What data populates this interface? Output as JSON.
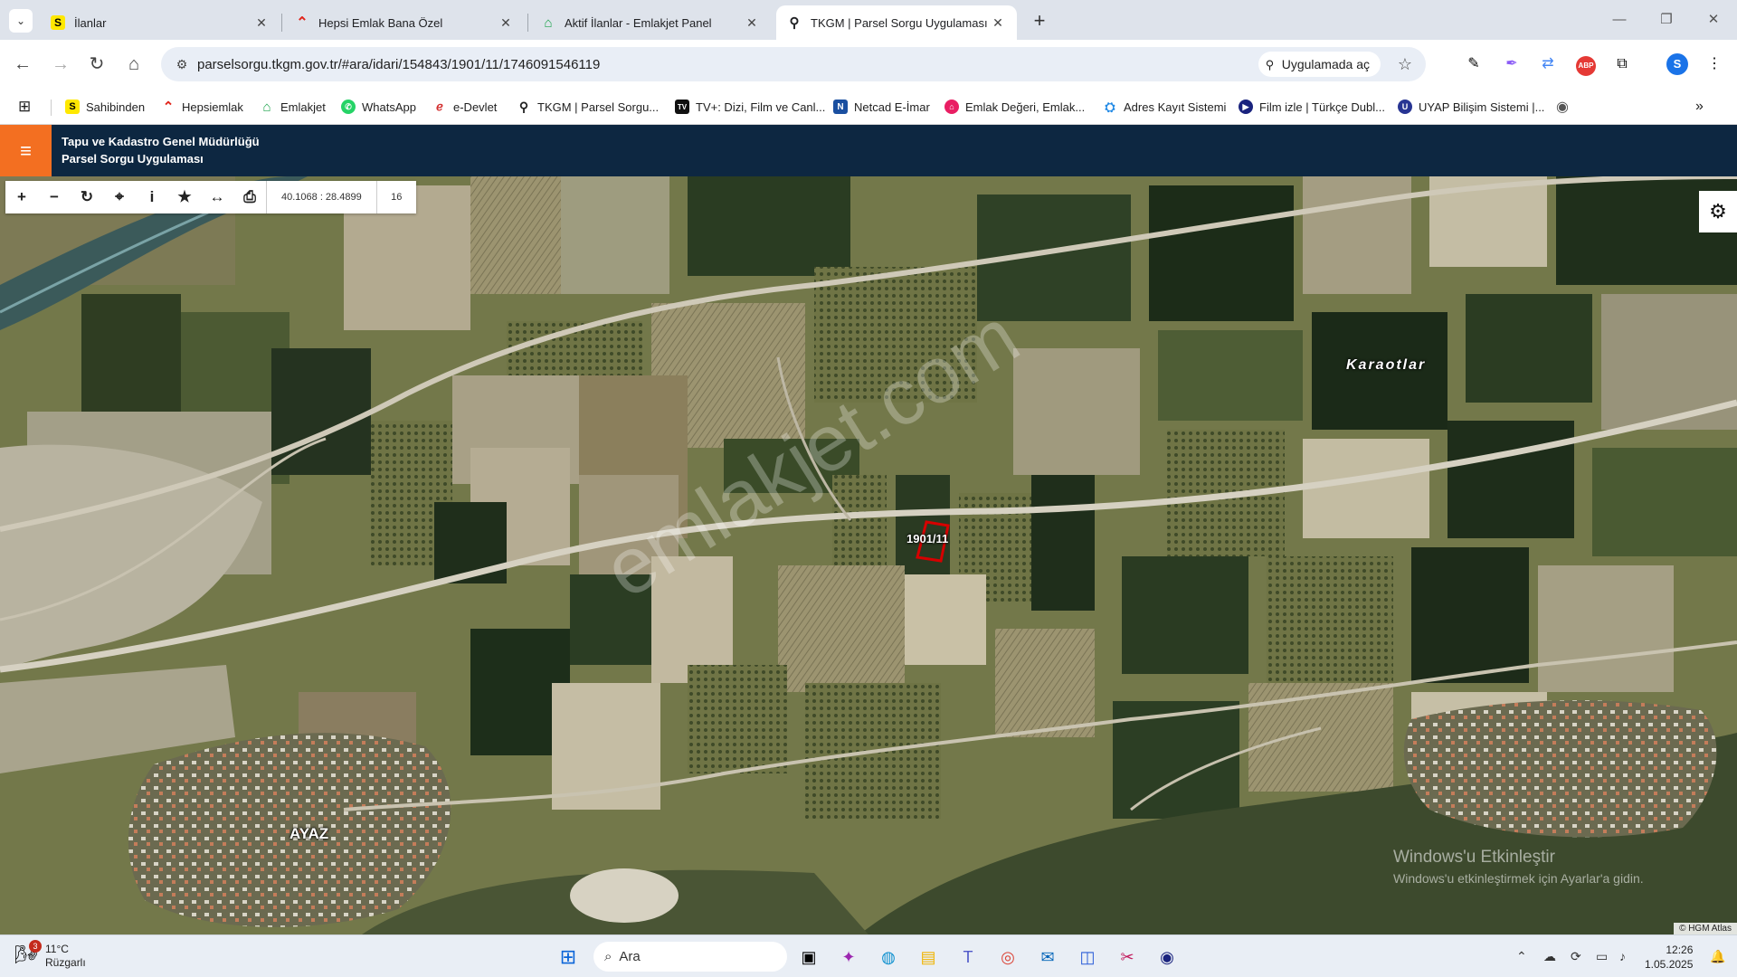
{
  "browser": {
    "tabs": [
      {
        "title": "İlanlar",
        "favicon": "sahibinden-icon"
      },
      {
        "title": "Hepsi Emlak Bana Özel",
        "favicon": "hepsiemlak-icon"
      },
      {
        "title": "Aktif İlanlar - Emlakjet Panel",
        "favicon": "emlakjet-icon"
      },
      {
        "title": "TKGM | Parsel Sorgu Uygulaması",
        "favicon": "location-pin-icon",
        "active": true
      }
    ],
    "url": "parselsorgu.tkgm.gov.tr/#ara/idari/154843/1901/11/1746091546119",
    "open_in_app_label": "Uygulamada aç",
    "profile_initial": "S",
    "bookmarks": [
      {
        "label": "Sahibinden",
        "icon": "sahibinden-icon"
      },
      {
        "label": "Hepsiemlak",
        "icon": "hepsiemlak-icon"
      },
      {
        "label": "Emlakjet",
        "icon": "emlakjet-icon"
      },
      {
        "label": "WhatsApp",
        "icon": "whatsapp-icon"
      },
      {
        "label": "e-Devlet",
        "icon": "edevlet-icon"
      },
      {
        "label": "TKGM | Parsel Sorgu...",
        "icon": "location-pin-icon"
      },
      {
        "label": "TV+: Dizi, Film ve Canl...",
        "icon": "tvplus-icon"
      },
      {
        "label": "Netcad E-İmar",
        "icon": "netcad-icon"
      },
      {
        "label": "Emlak Değeri, Emlak...",
        "icon": "emlak-degeri-icon"
      },
      {
        "label": "Adres Kayıt Sistemi",
        "icon": "adres-icon"
      },
      {
        "label": "Film izle | Türkçe Dubl...",
        "icon": "film-icon"
      },
      {
        "label": "UYAP Bilişim Sistemi |...",
        "icon": "uyap-icon"
      }
    ]
  },
  "app": {
    "title_line1": "Tapu ve Kadastro Genel Müdürlüğü",
    "title_line2": "Parsel Sorgu Uygulaması",
    "coordinates": "40.1068 : 28.4899",
    "zoom": "16",
    "accent_color": "#f36f21",
    "header_color": "#0d2741"
  },
  "map": {
    "village_labels": [
      "Karaotlar",
      "AYAZ"
    ],
    "parcel_label": "1901/11",
    "watermark": "emlakjet.com",
    "attribution": "© HGM Atlas",
    "windows_activation_line1": "Windows'u Etkinleştir",
    "windows_activation_line2": "Windows'u etkinleştirmek için Ayarlar'a gidin."
  },
  "taskbar": {
    "weather_temp": "11°C",
    "weather_desc": "Rüzgarlı",
    "weather_badge": "3",
    "search_placeholder": "Ara",
    "time": "12:26",
    "date": "1.05.2025"
  }
}
